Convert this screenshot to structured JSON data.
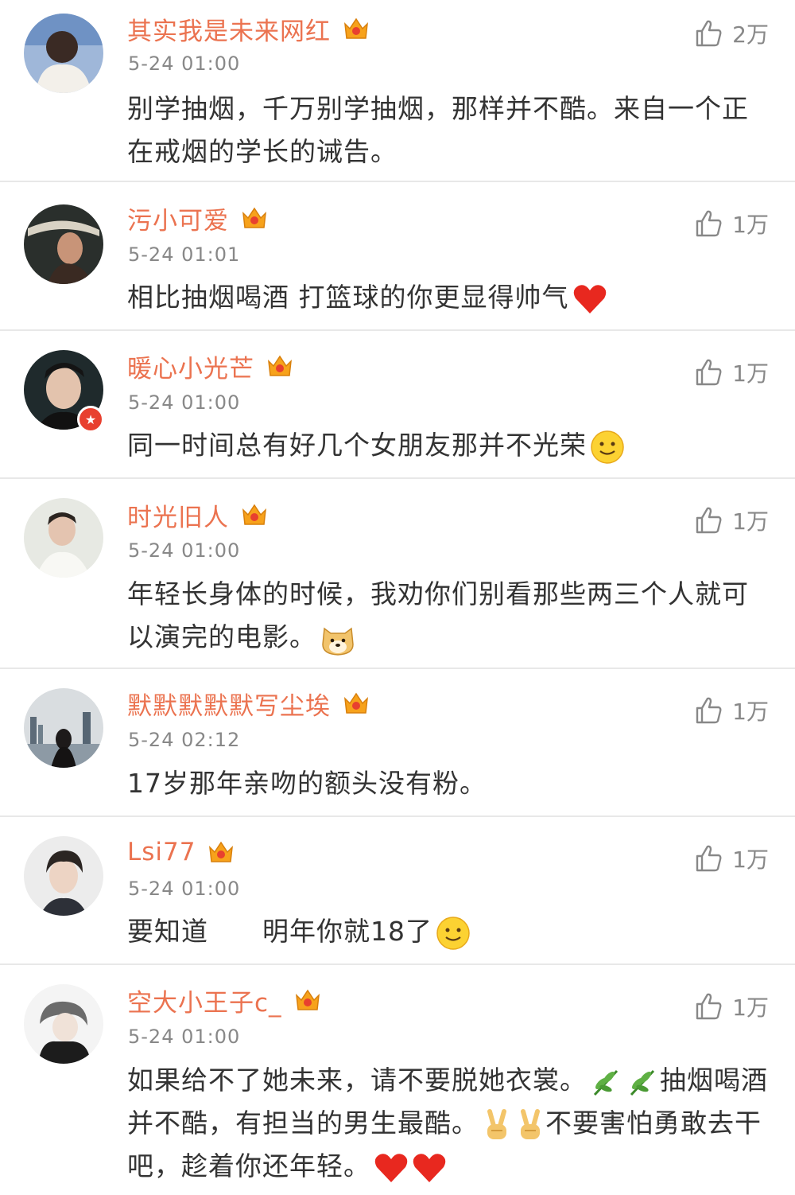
{
  "comments": [
    {
      "username": "其实我是未来网红",
      "time": "5-24 01:00",
      "likes": "2万",
      "text": "别学抽烟，千万别学抽烟，那样并不酷。来自一个正在戒烟的学长的诫告。"
    },
    {
      "username": "污小可爱",
      "time": "5-24 01:01",
      "likes": "1万",
      "text": "相比抽烟喝酒  打篮球的你更显得帅气"
    },
    {
      "username": "暖心小光芒",
      "time": "5-24 01:00",
      "likes": "1万",
      "text": "同一时间总有好几个女朋友那并不光荣"
    },
    {
      "username": "时光旧人",
      "time": "5-24 01:00",
      "likes": "1万",
      "text": "年轻长身体的时候，我劝你们别看那些两三个人就可以演完的电影。"
    },
    {
      "username": "默默默默默写尘埃",
      "time": "5-24 02:12",
      "likes": "1万",
      "text": "17岁那年亲吻的额头没有粉。"
    },
    {
      "username": "Lsi77",
      "time": "5-24 01:00",
      "likes": "1万",
      "text": "要知道　　明年你就18了"
    },
    {
      "username": "空大小王子c_",
      "time": "5-24 01:00",
      "likes": "1万",
      "text_parts": [
        "如果给不了她未来，请不要脱她衣裳。",
        "抽烟喝酒并不酷，有担当的男生最酷。",
        "不要害怕勇敢去干吧，趁着你还年轻。"
      ]
    }
  ],
  "colors": {
    "username": "#eb7350",
    "meta": "#888888",
    "text": "#333333",
    "divider": "#e8e8e8"
  },
  "icons": {
    "vip": "vip-crown-icon",
    "like": "thumbs-up-icon",
    "heart": "heart-emoji",
    "smile": "smile-emoji",
    "doge": "doge-emoji",
    "plant": "plant-emoji",
    "victory": "victory-hand-emoji"
  }
}
